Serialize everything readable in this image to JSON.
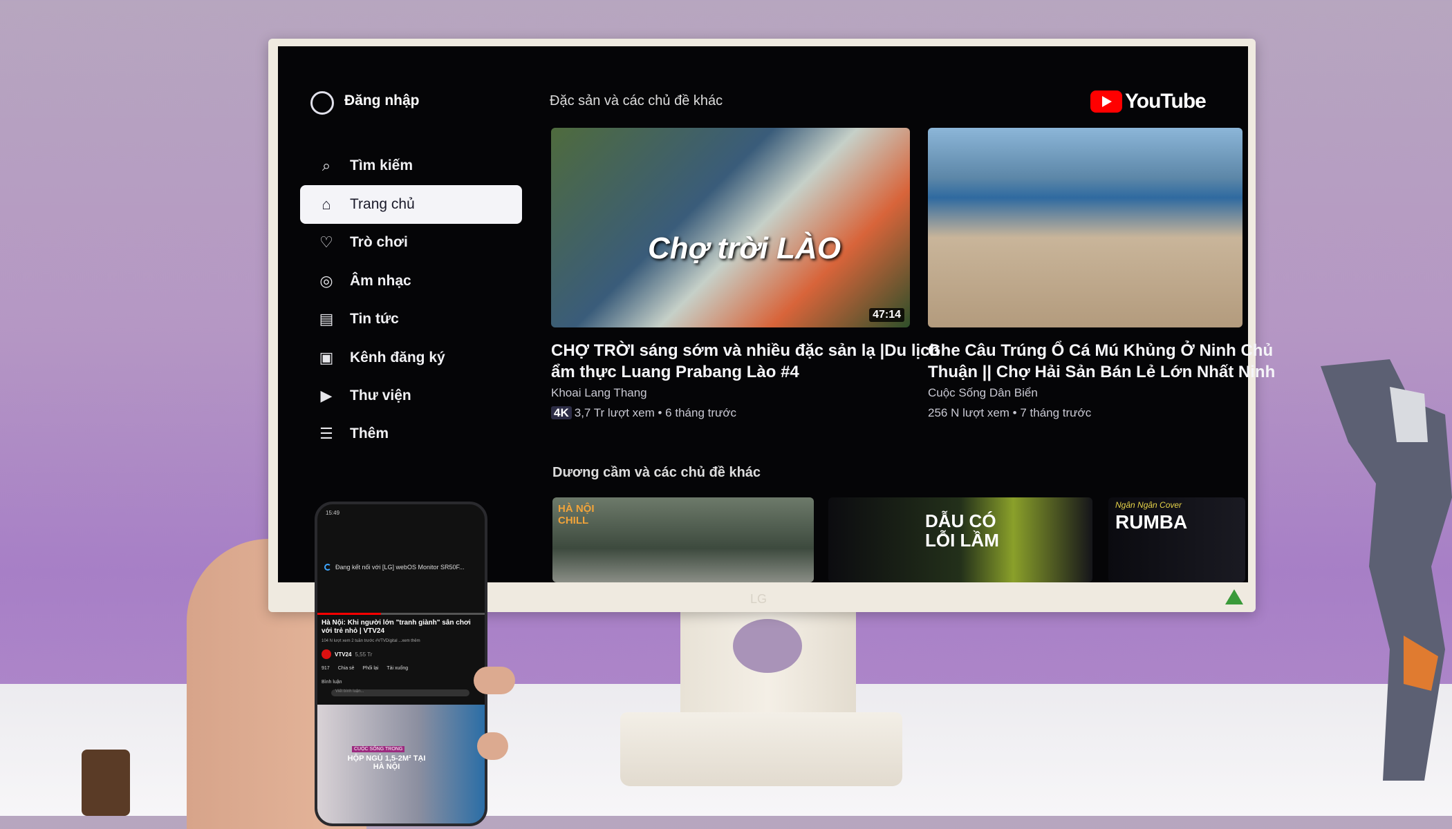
{
  "sidebar": {
    "sign_in": "Đăng nhập",
    "items": [
      {
        "label": "Tìm kiếm",
        "icon": "search-icon"
      },
      {
        "label": "Trang chủ",
        "icon": "home-icon",
        "selected": true
      },
      {
        "label": "Trò chơi",
        "icon": "gamepad-icon"
      },
      {
        "label": "Âm nhạc",
        "icon": "music-icon"
      },
      {
        "label": "Tin tức",
        "icon": "news-icon"
      },
      {
        "label": "Kênh đăng ký",
        "icon": "subscriptions-icon"
      },
      {
        "label": "Thư viện",
        "icon": "library-icon"
      },
      {
        "label": "Thêm",
        "icon": "menu-icon"
      }
    ]
  },
  "logo": "YouTube",
  "sections": [
    {
      "title": "Đặc sản và các chủ đề khác",
      "videos": [
        {
          "title_line1": "CHỢ TRỜI sáng sớm và nhiều đặc sản lạ |Du lịch",
          "title_line2": "ẩm thực Luang Prabang Lào #4",
          "channel": "Khoai Lang Thang",
          "badge": "4K",
          "meta": "3,7 Tr lượt xem • 6 tháng trước",
          "duration": "47:14",
          "thumb_text": "Chợ trời LÀO"
        },
        {
          "title_line1": "Ghe Câu Trúng Ổ Cá Mú Khủng Ở Ninh Chủ",
          "title_line2": "Thuận || Chợ Hải Sản Bán Lẻ Lớn Nhất Ninh",
          "channel": "Cuộc Sống Dân Biển",
          "meta": "256 N lượt xem • 7 tháng trước"
        }
      ]
    },
    {
      "title": "Dương cầm và các chủ đề khác",
      "thumbs": [
        {
          "text": "HÀ NỘI CHILL"
        },
        {
          "text": "DẪU CÓ LỖI LẦM"
        },
        {
          "text": "RUMBA",
          "text2": "Ngân Ngân Cover"
        }
      ]
    }
  ],
  "monitor_brand": "LG",
  "phone": {
    "time": "15:49",
    "cast_status": "Đang kết nối với [LG] webOS Monitor SR50F...",
    "video_title": "Hà Nội: Khi người lớn \"tranh giành\" sân chơi với trẻ nhỏ | VTV24",
    "video_meta": "104 N lượt xem  2 tuần trước  #VTVDigital  ...xem thêm",
    "channel": "VTV24",
    "subs": "5,55 Tr",
    "likes": "917",
    "share": "Chia sẻ",
    "remix": "Phối lại",
    "download": "Tải xuống",
    "comments": "Bình luận",
    "comment_placeholder": "Viết bình luận...",
    "next_thumb_tag": "CUỘC SỐNG TRONG",
    "next_thumb_text": "HỘP NGỦ 1,5-2M² TẠI HÀ NỘI",
    "progress": 0.38
  }
}
